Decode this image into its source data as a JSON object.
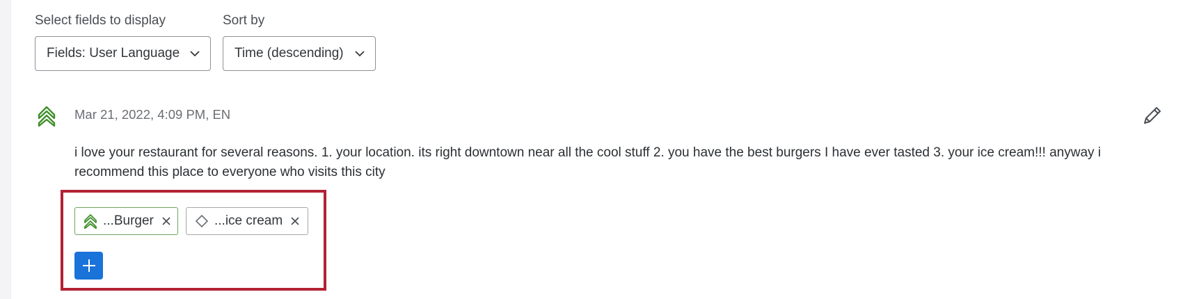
{
  "controls": {
    "fields_label": "Select fields to display",
    "fields_value": "Fields: User Language",
    "sort_label": "Sort by",
    "sort_value": "Time (descending)"
  },
  "response": {
    "meta": "Mar 21, 2022, 4:09 PM, EN",
    "sentiment_icon": "double-chevron-up-icon",
    "text": "i love your restaurant for several reasons. 1. your location. its right downtown near all the cool stuff 2. you have the best burgers I have ever tasted 3. your ice cream!!! anyway i recommend this place to everyone who visits this city"
  },
  "topics": [
    {
      "label": "...Burger",
      "sentiment": "positive",
      "icon": "double-chevron-up-icon"
    },
    {
      "label": "...ice cream",
      "sentiment": "neutral",
      "icon": "diamond-icon"
    }
  ],
  "colors": {
    "positive": "#3f8f2a",
    "accent_blue": "#1a73d9",
    "highlight_red": "#b22234"
  }
}
